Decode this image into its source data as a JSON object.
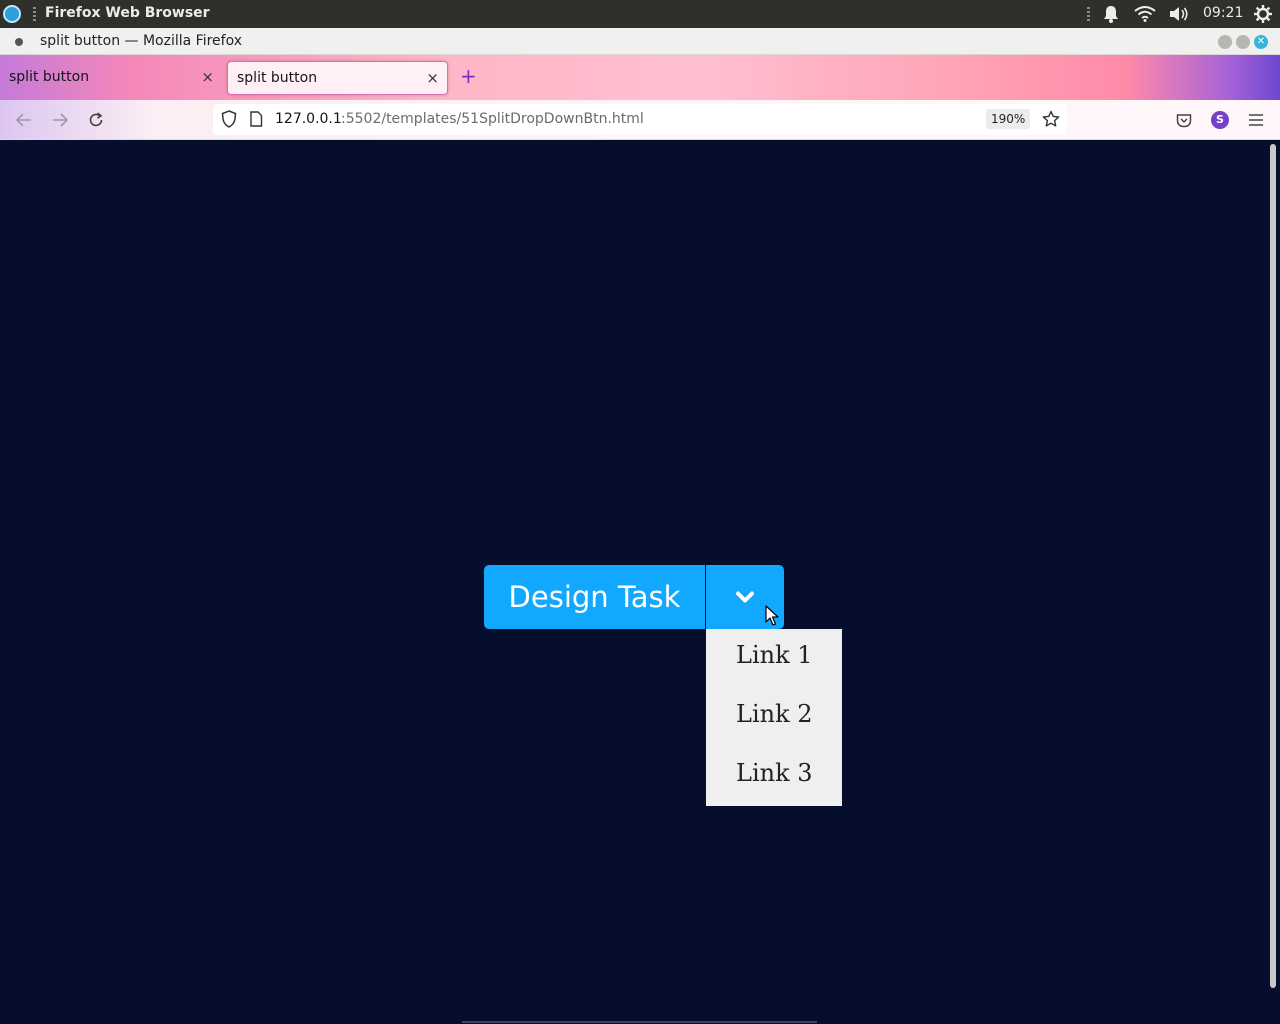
{
  "system_bar": {
    "app_name": "Firefox Web Browser",
    "clock": "09:21"
  },
  "window": {
    "title": "split button — Mozilla Firefox"
  },
  "tabs": [
    {
      "label": "split button",
      "active": false
    },
    {
      "label": "split button",
      "active": true
    }
  ],
  "new_tab_symbol": "+",
  "tab_close_symbol": "×",
  "address_bar": {
    "host": "127.0.0.1",
    "path": ":5502/templates/51SplitDropDownBtn.html",
    "zoom": "190%"
  },
  "account_initial": "S",
  "page": {
    "background_color": "#050e2d",
    "split_button": {
      "label": "Design Task",
      "color": "#12a8ff",
      "toggle_icon": "chevron-down-icon"
    },
    "dropdown": {
      "items": [
        "Link 1",
        "Link 2",
        "Link 3"
      ]
    }
  }
}
